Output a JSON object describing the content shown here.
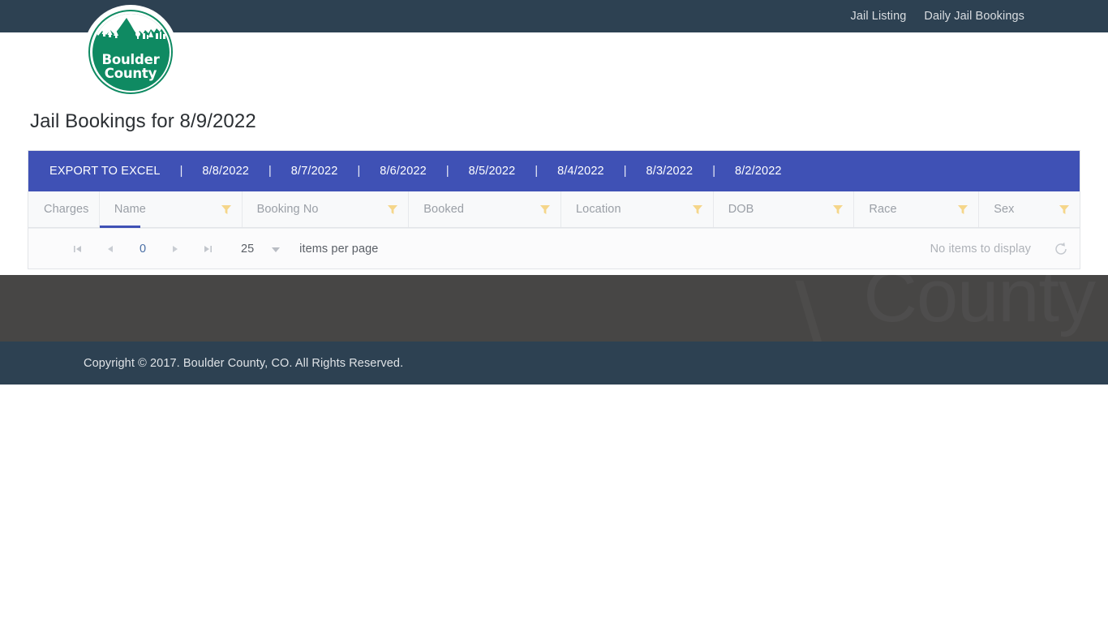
{
  "navbar": {
    "links": [
      {
        "label": "Jail Listing",
        "name": "nav-jail-listing"
      },
      {
        "label": "Daily Jail Bookings",
        "name": "nav-daily-jail-bookings"
      }
    ]
  },
  "logo": {
    "line1": "Boulder",
    "line2": "County",
    "color": "#0f8a62"
  },
  "page": {
    "title": "Jail Bookings for 8/9/2022"
  },
  "toolbar": {
    "accent_color": "#3f51b5",
    "export_label": "EXPORT TO EXCEL",
    "separator": "|",
    "dates": [
      "8/8/2022",
      "8/7/2022",
      "8/6/2022",
      "8/5/2022",
      "8/4/2022",
      "8/3/2022",
      "8/2/2022"
    ]
  },
  "grid": {
    "columns": [
      {
        "label": "Charges",
        "filter": false,
        "sorted": false
      },
      {
        "label": "Name",
        "filter": true,
        "sorted": true
      },
      {
        "label": "Booking No",
        "filter": true,
        "sorted": false
      },
      {
        "label": "Booked",
        "filter": true,
        "sorted": false
      },
      {
        "label": "Location",
        "filter": true,
        "sorted": false
      },
      {
        "label": "DOB",
        "filter": true,
        "sorted": false
      },
      {
        "label": "Race",
        "filter": true,
        "sorted": false
      },
      {
        "label": "Sex",
        "filter": true,
        "sorted": false
      }
    ],
    "rows": [],
    "filter_icon_color": "#f5d68a",
    "pager": {
      "first_icon": "go-to-first-page-icon",
      "prev_icon": "go-to-previous-page-icon",
      "page_number": "0",
      "next_icon": "go-to-next-page-icon",
      "last_icon": "go-to-last-page-icon",
      "page_size": "25",
      "page_size_label": "items per page",
      "status": "No items to display",
      "refresh_icon": "refresh-icon"
    }
  },
  "watermark": {
    "text": "County"
  },
  "footer": {
    "copyright": "Copyright © 2017. Boulder County, CO. All Rights Reserved."
  }
}
